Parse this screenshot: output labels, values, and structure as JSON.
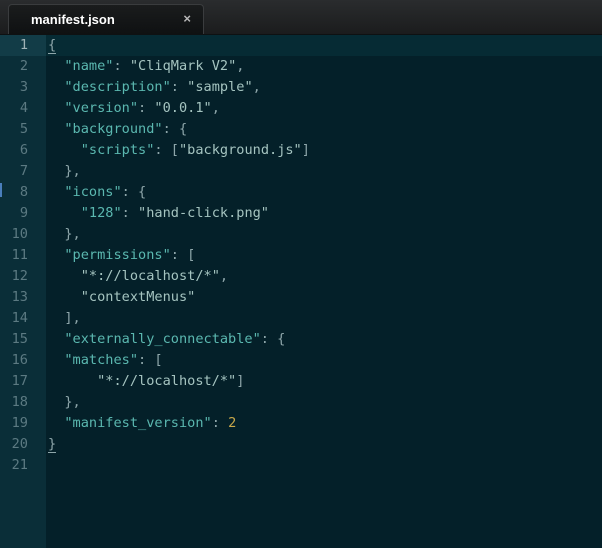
{
  "tab": {
    "title": "manifest.json",
    "close_glyph": "×"
  },
  "line_numbers": [
    "1",
    "2",
    "3",
    "4",
    "5",
    "6",
    "7",
    "8",
    "9",
    "10",
    "11",
    "12",
    "13",
    "14",
    "15",
    "16",
    "17",
    "18",
    "19",
    "20",
    "21"
  ],
  "lines": [
    {
      "indent": "",
      "parts": [
        {
          "t": "{",
          "c": "p"
        }
      ]
    },
    {
      "indent": "  ",
      "parts": [
        {
          "t": "\"name\"",
          "c": "k"
        },
        {
          "t": ": ",
          "c": "p"
        },
        {
          "t": "\"CliqMark V2\"",
          "c": "s"
        },
        {
          "t": ",",
          "c": "p"
        }
      ]
    },
    {
      "indent": "  ",
      "parts": [
        {
          "t": "\"description\"",
          "c": "k"
        },
        {
          "t": ": ",
          "c": "p"
        },
        {
          "t": "\"sample\"",
          "c": "s"
        },
        {
          "t": ",",
          "c": "p"
        }
      ]
    },
    {
      "indent": "  ",
      "parts": [
        {
          "t": "\"version\"",
          "c": "k"
        },
        {
          "t": ": ",
          "c": "p"
        },
        {
          "t": "\"0.0.1\"",
          "c": "s"
        },
        {
          "t": ",",
          "c": "p"
        }
      ]
    },
    {
      "indent": "  ",
      "parts": [
        {
          "t": "\"background\"",
          "c": "k"
        },
        {
          "t": ": {",
          "c": "p"
        }
      ]
    },
    {
      "indent": "    ",
      "parts": [
        {
          "t": "\"scripts\"",
          "c": "k"
        },
        {
          "t": ": [",
          "c": "p"
        },
        {
          "t": "\"background.js\"",
          "c": "s"
        },
        {
          "t": "]",
          "c": "p"
        }
      ]
    },
    {
      "indent": "  ",
      "parts": [
        {
          "t": "},",
          "c": "p"
        }
      ]
    },
    {
      "indent": "  ",
      "parts": [
        {
          "t": "\"icons\"",
          "c": "k"
        },
        {
          "t": ": {",
          "c": "p"
        }
      ]
    },
    {
      "indent": "    ",
      "parts": [
        {
          "t": "\"128\"",
          "c": "k"
        },
        {
          "t": ": ",
          "c": "p"
        },
        {
          "t": "\"hand-click.png\"",
          "c": "s"
        }
      ]
    },
    {
      "indent": "  ",
      "parts": [
        {
          "t": "},",
          "c": "p"
        }
      ]
    },
    {
      "indent": "  ",
      "parts": [
        {
          "t": "\"permissions\"",
          "c": "k"
        },
        {
          "t": ": [",
          "c": "p"
        }
      ]
    },
    {
      "indent": "    ",
      "parts": [
        {
          "t": "\"*://localhost/*\"",
          "c": "s"
        },
        {
          "t": ",",
          "c": "p"
        }
      ]
    },
    {
      "indent": "    ",
      "parts": [
        {
          "t": "\"contextMenus\"",
          "c": "s"
        }
      ]
    },
    {
      "indent": "  ",
      "parts": [
        {
          "t": "],",
          "c": "p"
        }
      ]
    },
    {
      "indent": "  ",
      "parts": [
        {
          "t": "\"externally_connectable\"",
          "c": "k"
        },
        {
          "t": ": {",
          "c": "p"
        }
      ]
    },
    {
      "indent": "  ",
      "parts": [
        {
          "t": "\"matches\"",
          "c": "k"
        },
        {
          "t": ": [",
          "c": "p"
        }
      ]
    },
    {
      "indent": "      ",
      "parts": [
        {
          "t": "\"*://localhost/*\"",
          "c": "s"
        },
        {
          "t": "]",
          "c": "p"
        }
      ]
    },
    {
      "indent": "  ",
      "parts": [
        {
          "t": "},",
          "c": "p"
        }
      ]
    },
    {
      "indent": "  ",
      "parts": [
        {
          "t": "\"manifest_version\"",
          "c": "k"
        },
        {
          "t": ": ",
          "c": "p"
        },
        {
          "t": "2",
          "c": "n"
        }
      ]
    },
    {
      "indent": "",
      "parts": [
        {
          "t": "}",
          "c": "p"
        }
      ]
    },
    {
      "indent": "",
      "parts": []
    }
  ],
  "colors": {
    "background": "#042029",
    "gutter": "#0a2e38",
    "key": "#5bb8b0",
    "string": "#a5c4c0",
    "punctuation": "#8ea6aa",
    "number": "#c9a84a",
    "line_number": "#5c7a82"
  },
  "icons": {
    "close": "close-icon"
  }
}
